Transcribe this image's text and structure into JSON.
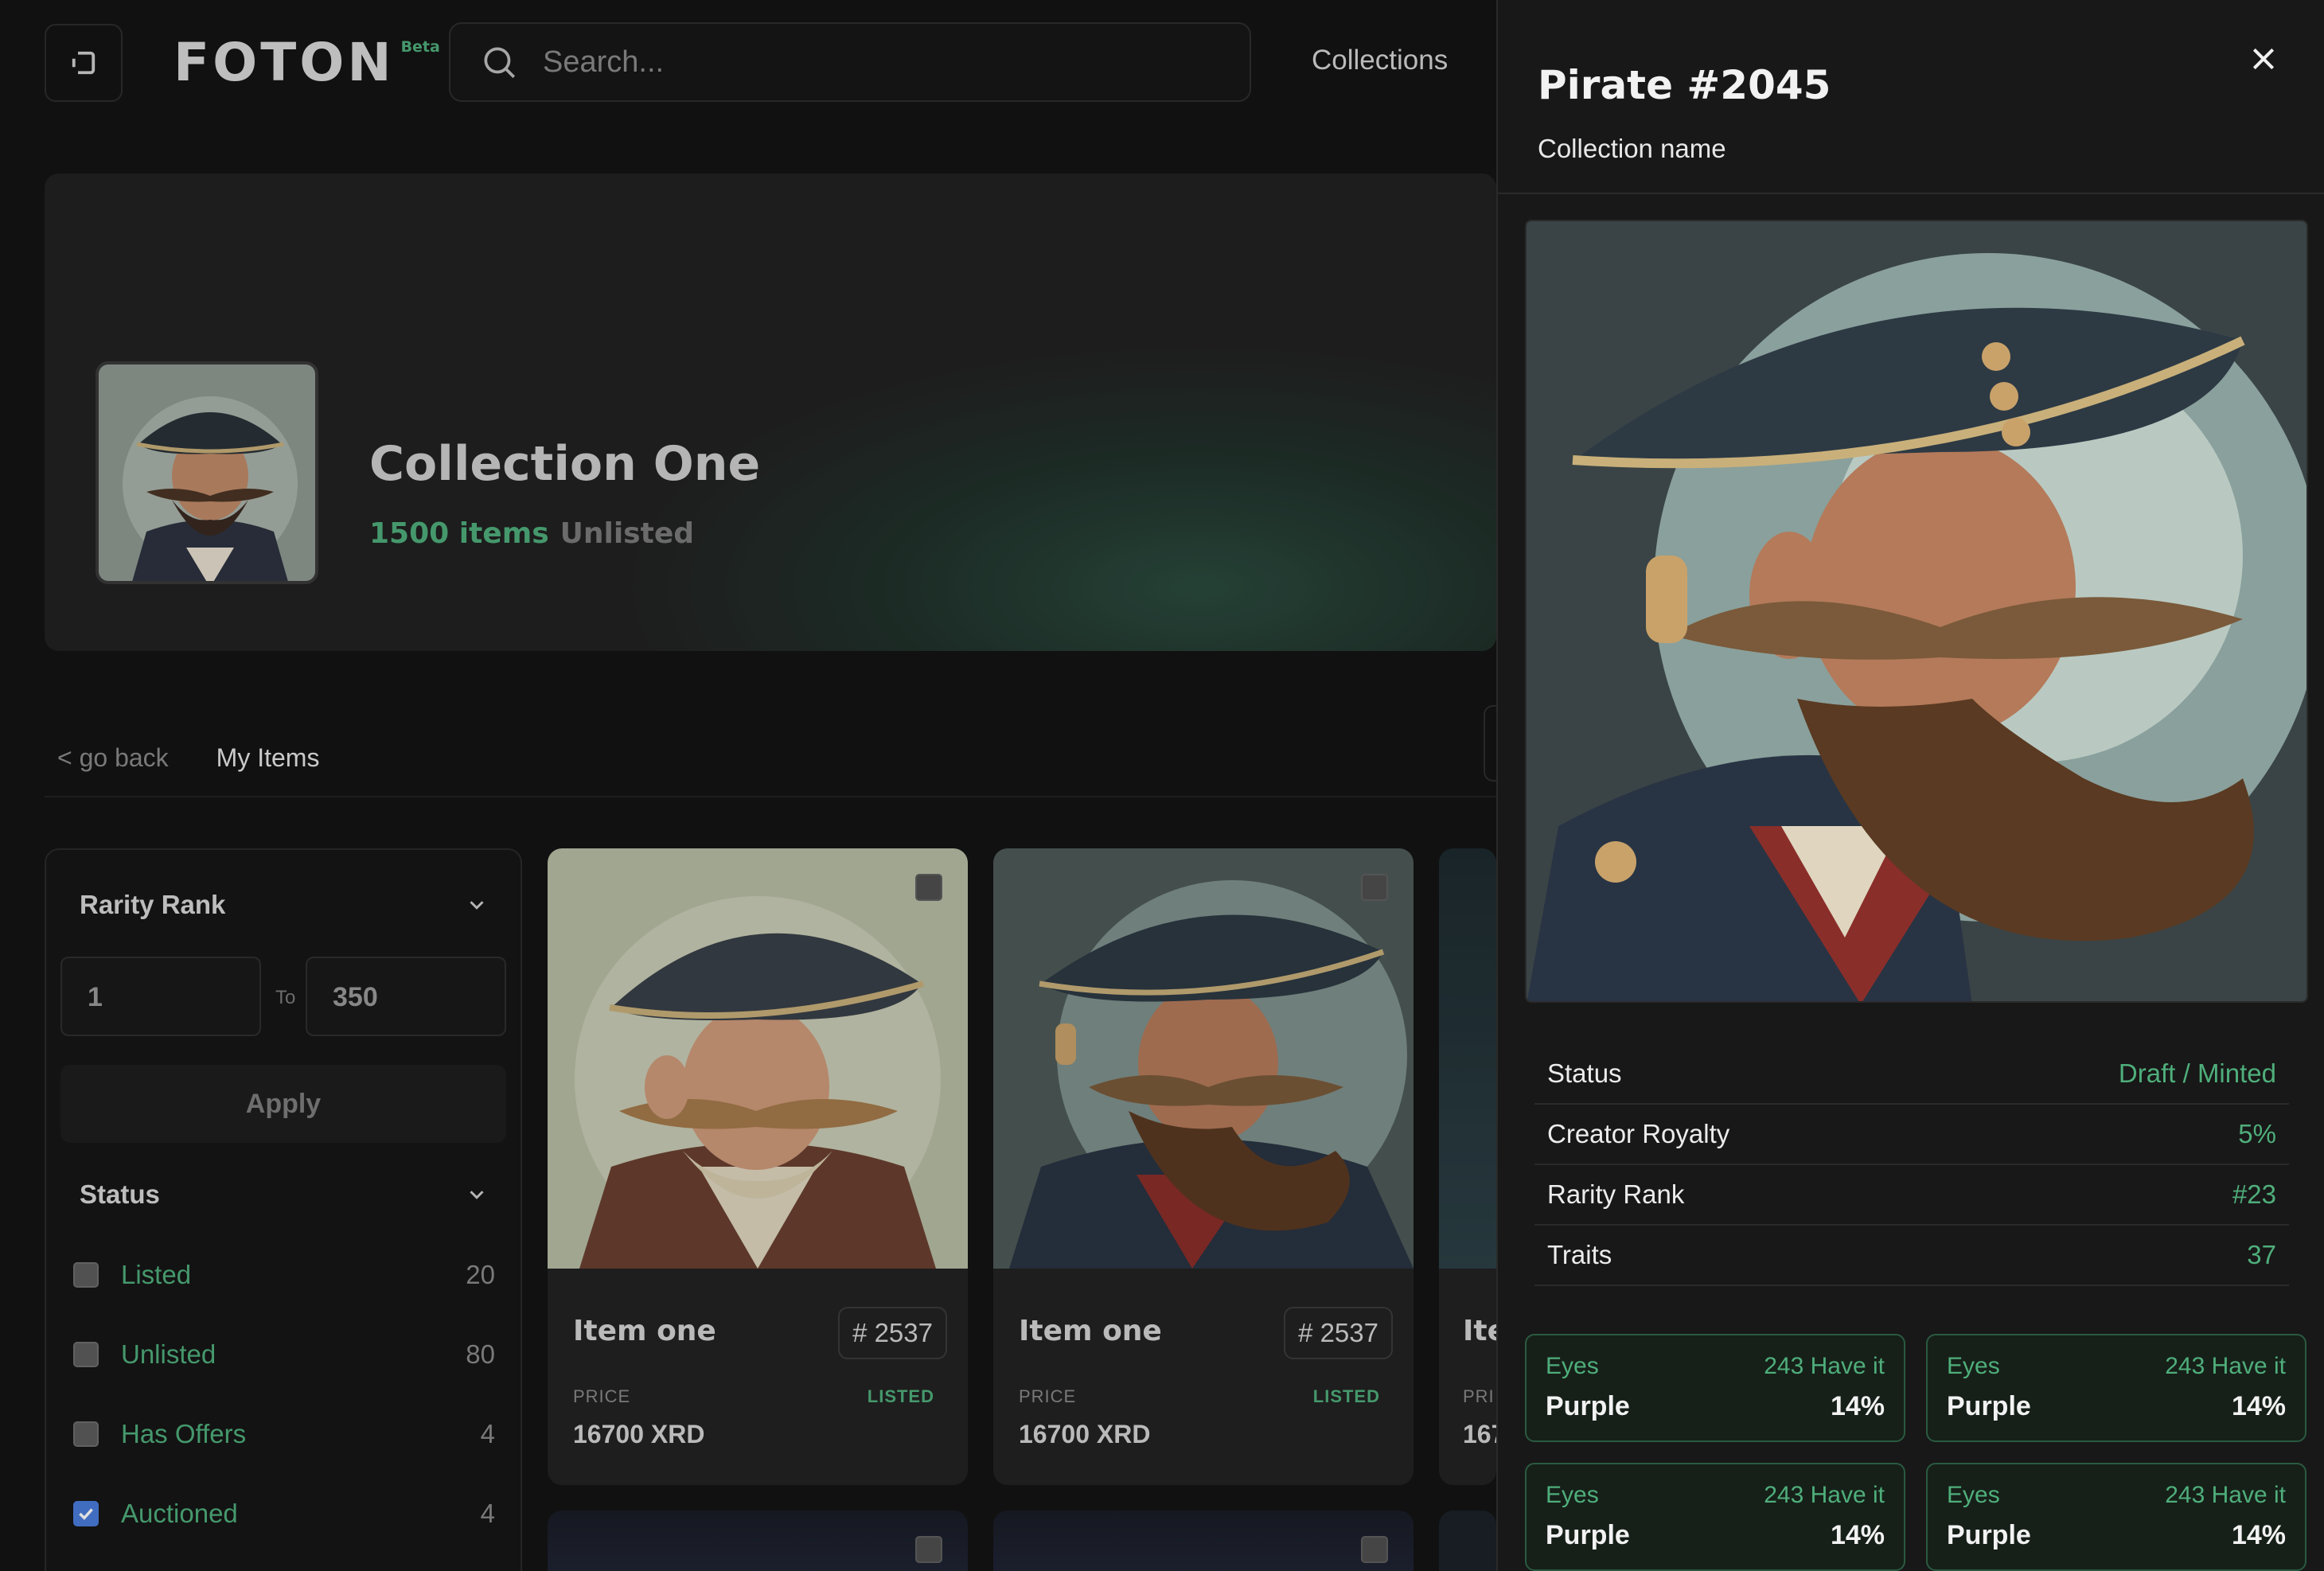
{
  "header": {
    "logo": "FOTON",
    "logo_badge": "Beta",
    "search_placeholder": "Search...",
    "nav_collections": "Collections",
    "icons": [
      "sidebar-toggle-icon",
      "search-icon"
    ]
  },
  "hero": {
    "title": "Collection One",
    "items_count": "1500 items",
    "status": "Unlisted"
  },
  "breadcrumb": {
    "back": "< go back",
    "current": "My Items"
  },
  "filters": {
    "rarity_rank": {
      "label": "Rarity Rank",
      "from": "1",
      "to_label": "To",
      "to": "350",
      "apply": "Apply"
    },
    "status": {
      "label": "Status",
      "options": [
        {
          "label": "Listed",
          "count": "20",
          "checked": false
        },
        {
          "label": "Unlisted",
          "count": "80",
          "checked": false
        },
        {
          "label": "Has Offers",
          "count": "4",
          "checked": false
        },
        {
          "label": "Auctioned",
          "count": "4",
          "checked": true
        }
      ]
    }
  },
  "items": [
    {
      "name": "Item one",
      "number": "# 2537",
      "price_label": "PRICE",
      "status": "LISTED",
      "price": "16700 XRD"
    },
    {
      "name": "Item one",
      "number": "# 2537",
      "price_label": "PRICE",
      "status": "LISTED",
      "price": "16700 XRD"
    },
    {
      "name": "Ite",
      "number": "",
      "price_label": "PRI",
      "status": "",
      "price": "167"
    }
  ],
  "detail": {
    "title": "Pirate #2045",
    "collection": "Collection name",
    "rows": [
      {
        "label": "Status",
        "value": "Draft / Minted"
      },
      {
        "label": "Creator Royalty",
        "value": "5%"
      },
      {
        "label": "Rarity Rank",
        "value": "#23"
      },
      {
        "label": "Traits",
        "value": "37"
      }
    ],
    "traits": [
      {
        "type": "Eyes",
        "count": "243  Have it",
        "value": "Purple",
        "percent": "14%"
      },
      {
        "type": "Eyes",
        "count": "243  Have it",
        "value": "Purple",
        "percent": "14%"
      },
      {
        "type": "Eyes",
        "count": "243  Have it",
        "value": "Purple",
        "percent": "14%"
      },
      {
        "type": "Eyes",
        "count": "243  Have it",
        "value": "Purple",
        "percent": "14%"
      }
    ]
  },
  "colors": {
    "accent_green": "#4fae7b",
    "background": "#141414",
    "drawer_bg": "#181818",
    "checkbox_checked": "#4a7ddc"
  }
}
